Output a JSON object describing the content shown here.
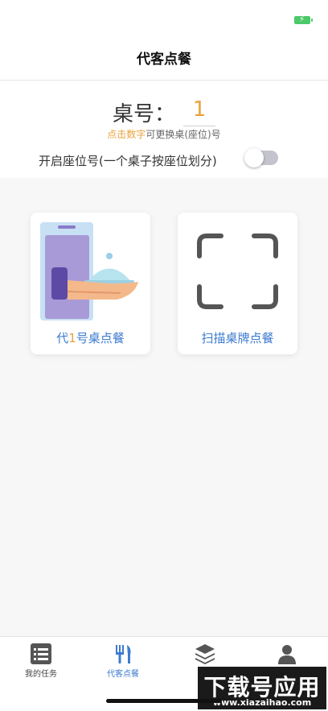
{
  "nav": {
    "title": "代客点餐"
  },
  "table": {
    "label": "桌号：",
    "number": "1"
  },
  "hint": {
    "accent": "点击数字",
    "rest": "可更换桌(座位)号"
  },
  "seat_toggle": {
    "label": "开启座位号(一个桌子按座位划分)",
    "enabled": false
  },
  "cards": [
    {
      "prefix": "代",
      "number": "1",
      "suffix": "号桌点餐"
    },
    {
      "label": "扫描桌牌点餐"
    }
  ],
  "tabs": [
    {
      "label": "我的任务",
      "icon": "list-icon",
      "active": false
    },
    {
      "label": "代客点餐",
      "icon": "fork-knife-icon",
      "active": true
    },
    {
      "label": "",
      "icon": "layers-icon",
      "active": false
    },
    {
      "label": "",
      "icon": "person-icon",
      "active": false
    }
  ],
  "watermark": {
    "main": "下载号应用",
    "sub": "www.xiazaihao.com"
  },
  "colors": {
    "accent": "#e9a23b",
    "link": "#3c7bd0",
    "battery": "#4cc96b",
    "toggle_track": "#c4c4cc"
  }
}
